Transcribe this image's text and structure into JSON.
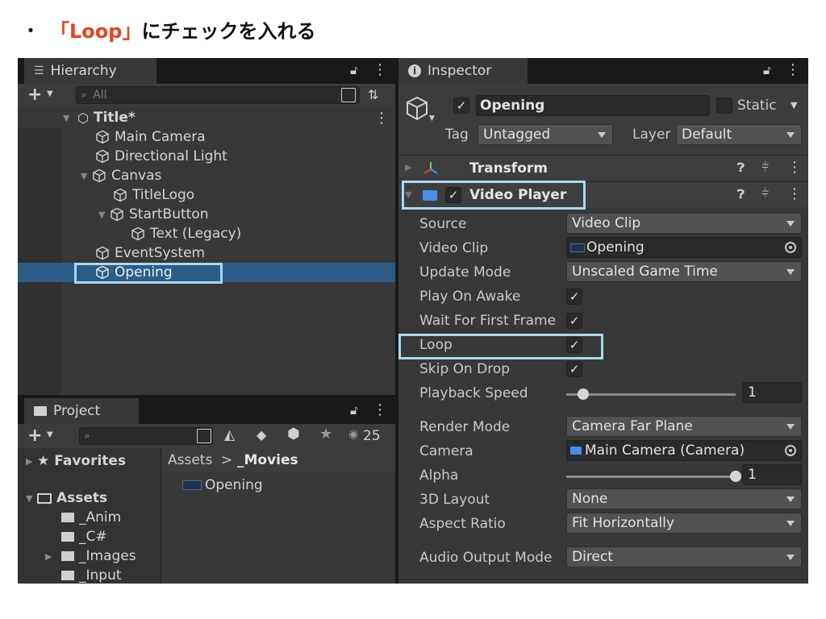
{
  "heading": {
    "bullet": "・",
    "highlight": "「Loop」",
    "rest": "にチェックを入れる"
  },
  "hierarchy": {
    "tab_label": "Hierarchy",
    "search_placeholder": "All",
    "scene_name": "Title*",
    "items": [
      {
        "label": "Main Camera"
      },
      {
        "label": "Directional Light"
      },
      {
        "label": "Canvas"
      },
      {
        "label": "TitleLogo"
      },
      {
        "label": "StartButton"
      },
      {
        "label": "Text (Legacy)"
      },
      {
        "label": "EventSystem"
      },
      {
        "label": "Opening"
      }
    ]
  },
  "project": {
    "tab_label": "Project",
    "visibility_count": "25",
    "favorites_label": "Favorites",
    "assets_label": "Assets",
    "folders": [
      "_Anim",
      "_C#",
      "_Images",
      "_Input"
    ],
    "breadcrumb": {
      "root": "Assets",
      "separator": ">",
      "current": "_Movies"
    },
    "files": [
      {
        "label": "Opening"
      }
    ]
  },
  "inspector": {
    "tab_label": "Inspector",
    "object_name": "Opening",
    "static_label": "Static",
    "tag_label": "Tag",
    "tag_value": "Untagged",
    "layer_label": "Layer",
    "layer_value": "Default",
    "transform_title": "Transform",
    "video_player_title": "Video Player",
    "fields": {
      "source": {
        "label": "Source",
        "value": "Video Clip"
      },
      "video_clip": {
        "label": "Video Clip",
        "value": "Opening"
      },
      "update_mode": {
        "label": "Update Mode",
        "value": "Unscaled Game Time"
      },
      "play_on_awake": {
        "label": "Play On Awake",
        "checked": true
      },
      "wait_first_frame": {
        "label": "Wait For First Frame",
        "checked": true
      },
      "loop": {
        "label": "Loop",
        "checked": true
      },
      "skip_on_drop": {
        "label": "Skip On Drop",
        "checked": true
      },
      "playback_speed": {
        "label": "Playback Speed",
        "value": "1",
        "slider_fraction": 0.1
      },
      "render_mode": {
        "label": "Render Mode",
        "value": "Camera Far Plane"
      },
      "camera": {
        "label": "Camera",
        "value": "Main Camera (Camera)"
      },
      "alpha": {
        "label": "Alpha",
        "value": "1",
        "slider_fraction": 1.0
      },
      "layout_3d": {
        "label": "3D Layout",
        "value": "None"
      },
      "aspect_ratio": {
        "label": "Aspect Ratio",
        "value": "Fit Horizontally"
      },
      "audio_output": {
        "label": "Audio Output Mode",
        "value": "Direct"
      }
    },
    "check_glyph": "✓"
  },
  "colors": {
    "heading_accent": "#e8431e",
    "highlight_box": "#a9d9ee",
    "selection": "#2c5d87",
    "panel_bg": "#383838",
    "dark_bar": "#191919"
  }
}
